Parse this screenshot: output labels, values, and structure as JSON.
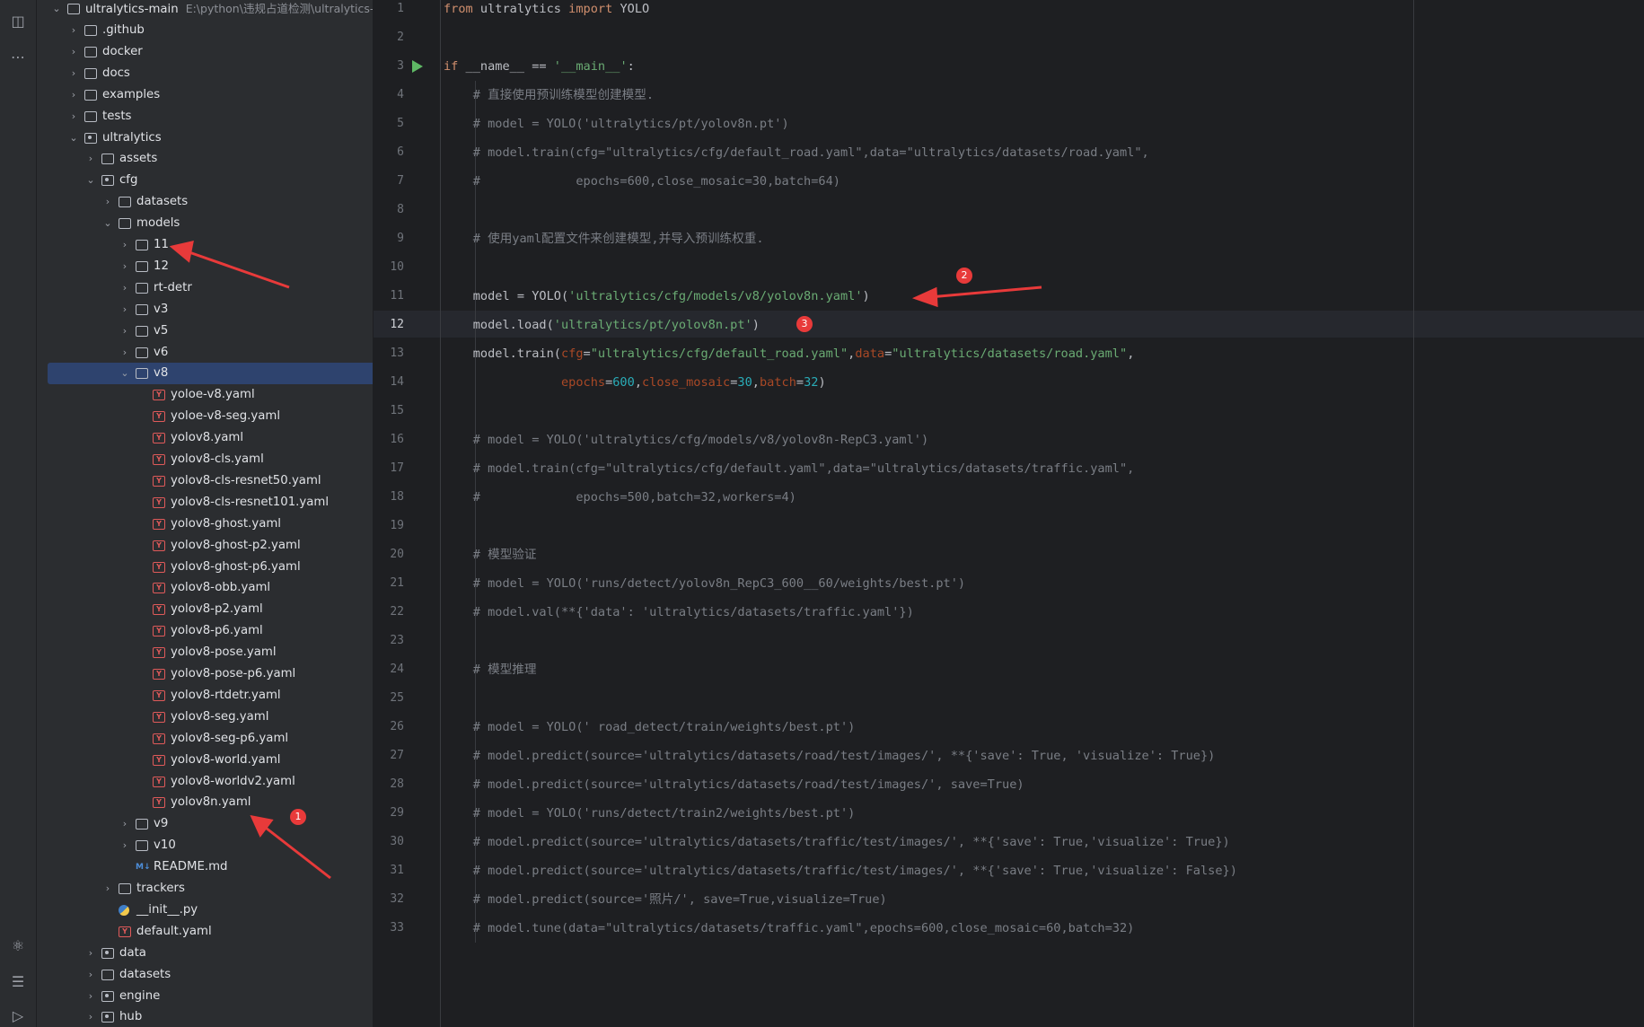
{
  "colors": {
    "accent_selected": "#2e436e",
    "annotation_red": "#e83a3a",
    "string_green": "#6aab73",
    "keyword_orange": "#cf8e6d",
    "comment_gray": "#7a7e85"
  },
  "activity": {
    "icons": [
      "structure-icon",
      "more-icon",
      "python-console-icon",
      "layers-icon",
      "services-icon"
    ]
  },
  "tree": {
    "root": {
      "label": "ultralytics-main",
      "path": "E:\\python\\违规占道检测\\ultralytics-m"
    },
    "rows": [
      {
        "label": ".github",
        "depth": 1,
        "type": "folder",
        "chev": "›"
      },
      {
        "label": "docker",
        "depth": 1,
        "type": "folder",
        "chev": "›"
      },
      {
        "label": "docs",
        "depth": 1,
        "type": "folder",
        "chev": "›"
      },
      {
        "label": "examples",
        "depth": 1,
        "type": "folder",
        "chev": "›"
      },
      {
        "label": "tests",
        "depth": 1,
        "type": "folder",
        "chev": "›"
      },
      {
        "label": "ultralytics",
        "depth": 1,
        "type": "pkg",
        "chev": "⌄"
      },
      {
        "label": "assets",
        "depth": 2,
        "type": "folder",
        "chev": "›"
      },
      {
        "label": "cfg",
        "depth": 2,
        "type": "pkg",
        "chev": "⌄"
      },
      {
        "label": "datasets",
        "depth": 3,
        "type": "folder",
        "chev": "›"
      },
      {
        "label": "models",
        "depth": 3,
        "type": "folder",
        "chev": "⌄"
      },
      {
        "label": "11",
        "depth": 4,
        "type": "folder",
        "chev": "›"
      },
      {
        "label": "12",
        "depth": 4,
        "type": "folder",
        "chev": "›"
      },
      {
        "label": "rt-detr",
        "depth": 4,
        "type": "folder",
        "chev": "›"
      },
      {
        "label": "v3",
        "depth": 4,
        "type": "folder",
        "chev": "›"
      },
      {
        "label": "v5",
        "depth": 4,
        "type": "folder",
        "chev": "›"
      },
      {
        "label": "v6",
        "depth": 4,
        "type": "folder",
        "chev": "›"
      },
      {
        "label": "v8",
        "depth": 4,
        "type": "folder",
        "chev": "⌄",
        "selected": true
      },
      {
        "label": "yoloe-v8.yaml",
        "depth": 5,
        "type": "yaml"
      },
      {
        "label": "yoloe-v8-seg.yaml",
        "depth": 5,
        "type": "yaml"
      },
      {
        "label": "yolov8.yaml",
        "depth": 5,
        "type": "yaml"
      },
      {
        "label": "yolov8-cls.yaml",
        "depth": 5,
        "type": "yaml"
      },
      {
        "label": "yolov8-cls-resnet50.yaml",
        "depth": 5,
        "type": "yaml"
      },
      {
        "label": "yolov8-cls-resnet101.yaml",
        "depth": 5,
        "type": "yaml"
      },
      {
        "label": "yolov8-ghost.yaml",
        "depth": 5,
        "type": "yaml"
      },
      {
        "label": "yolov8-ghost-p2.yaml",
        "depth": 5,
        "type": "yaml"
      },
      {
        "label": "yolov8-ghost-p6.yaml",
        "depth": 5,
        "type": "yaml"
      },
      {
        "label": "yolov8-obb.yaml",
        "depth": 5,
        "type": "yaml"
      },
      {
        "label": "yolov8-p2.yaml",
        "depth": 5,
        "type": "yaml"
      },
      {
        "label": "yolov8-p6.yaml",
        "depth": 5,
        "type": "yaml"
      },
      {
        "label": "yolov8-pose.yaml",
        "depth": 5,
        "type": "yaml"
      },
      {
        "label": "yolov8-pose-p6.yaml",
        "depth": 5,
        "type": "yaml"
      },
      {
        "label": "yolov8-rtdetr.yaml",
        "depth": 5,
        "type": "yaml"
      },
      {
        "label": "yolov8-seg.yaml",
        "depth": 5,
        "type": "yaml"
      },
      {
        "label": "yolov8-seg-p6.yaml",
        "depth": 5,
        "type": "yaml"
      },
      {
        "label": "yolov8-world.yaml",
        "depth": 5,
        "type": "yaml"
      },
      {
        "label": "yolov8-worldv2.yaml",
        "depth": 5,
        "type": "yaml"
      },
      {
        "label": "yolov8n.yaml",
        "depth": 5,
        "type": "yaml"
      },
      {
        "label": "v9",
        "depth": 4,
        "type": "folder",
        "chev": "›"
      },
      {
        "label": "v10",
        "depth": 4,
        "type": "folder",
        "chev": "›"
      },
      {
        "label": "README.md",
        "depth": 4,
        "type": "md"
      },
      {
        "label": "trackers",
        "depth": 3,
        "type": "folder",
        "chev": "›"
      },
      {
        "label": "__init__.py",
        "depth": 3,
        "type": "py"
      },
      {
        "label": "default.yaml",
        "depth": 3,
        "type": "yaml"
      },
      {
        "label": "data",
        "depth": 2,
        "type": "pkg",
        "chev": "›"
      },
      {
        "label": "datasets",
        "depth": 2,
        "type": "folder",
        "chev": "›"
      },
      {
        "label": "engine",
        "depth": 2,
        "type": "pkg",
        "chev": "›"
      },
      {
        "label": "hub",
        "depth": 2,
        "type": "pkg",
        "chev": "›"
      }
    ]
  },
  "editor": {
    "current_line": 12,
    "lines": [
      [
        [
          "kw",
          "from"
        ],
        [
          "t",
          " ultralytics "
        ],
        [
          "kw",
          "import"
        ],
        [
          "t",
          " YOLO"
        ]
      ],
      [],
      [
        [
          "kw",
          "if"
        ],
        [
          "t",
          " __name__ == "
        ],
        [
          "str",
          "'__main__'"
        ],
        [
          "t",
          ":"
        ]
      ],
      [
        [
          "t",
          "    "
        ],
        [
          "cm",
          "# 直接使用预训练模型创建模型."
        ]
      ],
      [
        [
          "t",
          "    "
        ],
        [
          "cm",
          "# model = YOLO('ultralytics/pt/yolov8n.pt')"
        ]
      ],
      [
        [
          "t",
          "    "
        ],
        [
          "cm",
          "# model.train(cfg=\"ultralytics/cfg/default_road.yaml\",data=\"ultralytics/datasets/road.yaml\","
        ]
      ],
      [
        [
          "t",
          "    "
        ],
        [
          "cm",
          "#             epochs=600,close_mosaic=30,batch=64)"
        ]
      ],
      [],
      [
        [
          "t",
          "    "
        ],
        [
          "cm",
          "# 使用yaml配置文件来创建模型,并导入预训练权重."
        ]
      ],
      [],
      [
        [
          "t",
          "    model = YOLO("
        ],
        [
          "str",
          "'ultralytics/cfg/models/v8/yolov8n.yaml'"
        ],
        [
          "t",
          ")"
        ]
      ],
      [
        [
          "t",
          "    model.load("
        ],
        [
          "str",
          "'ultralytics/pt/yolov8n.pt'"
        ],
        [
          "t",
          ")"
        ]
      ],
      [
        [
          "t",
          "    model.train("
        ],
        [
          "par",
          "cfg"
        ],
        [
          "t",
          "="
        ],
        [
          "str",
          "\"ultralytics/cfg/default_road.yaml\""
        ],
        [
          "t",
          ","
        ],
        [
          "par",
          "data"
        ],
        [
          "t",
          "="
        ],
        [
          "str",
          "\"ultralytics/datasets/road.yaml\""
        ],
        [
          "t",
          ","
        ]
      ],
      [
        [
          "t",
          "                "
        ],
        [
          "par",
          "epochs"
        ],
        [
          "t",
          "="
        ],
        [
          "num",
          "600"
        ],
        [
          "t",
          ","
        ],
        [
          "par",
          "close_mosaic"
        ],
        [
          "t",
          "="
        ],
        [
          "num",
          "30"
        ],
        [
          "t",
          ","
        ],
        [
          "par",
          "batch"
        ],
        [
          "t",
          "="
        ],
        [
          "num",
          "32"
        ],
        [
          "t",
          ")"
        ]
      ],
      [],
      [
        [
          "t",
          "    "
        ],
        [
          "cm",
          "# model = YOLO('ultralytics/cfg/models/v8/yolov8n-RepC3.yaml')"
        ]
      ],
      [
        [
          "t",
          "    "
        ],
        [
          "cm",
          "# model.train(cfg=\"ultralytics/cfg/default.yaml\",data=\"ultralytics/datasets/traffic.yaml\","
        ]
      ],
      [
        [
          "t",
          "    "
        ],
        [
          "cm",
          "#             epochs=500,batch=32,workers=4)"
        ]
      ],
      [],
      [
        [
          "t",
          "    "
        ],
        [
          "cm",
          "# 模型验证"
        ]
      ],
      [
        [
          "t",
          "    "
        ],
        [
          "cm",
          "# model = YOLO('runs/detect/yolov8n_RepC3_600__60/weights/best.pt')"
        ]
      ],
      [
        [
          "t",
          "    "
        ],
        [
          "cm",
          "# model.val(**{'data': 'ultralytics/datasets/traffic.yaml'})"
        ]
      ],
      [],
      [
        [
          "t",
          "    "
        ],
        [
          "cm",
          "# 模型推理"
        ]
      ],
      [],
      [
        [
          "t",
          "    "
        ],
        [
          "cm",
          "# model = YOLO(' road_detect/train/weights/best.pt')"
        ]
      ],
      [
        [
          "t",
          "    "
        ],
        [
          "cm",
          "# model.predict(source='ultralytics/datasets/road/test/images/', **{'save': True, 'visualize': True})"
        ]
      ],
      [
        [
          "t",
          "    "
        ],
        [
          "cm",
          "# model.predict(source='ultralytics/datasets/road/test/images/', save=True)"
        ]
      ],
      [
        [
          "t",
          "    "
        ],
        [
          "cm",
          "# model = YOLO('runs/detect/train2/weights/best.pt')"
        ]
      ],
      [
        [
          "t",
          "    "
        ],
        [
          "cm",
          "# model.predict(source='ultralytics/datasets/traffic/test/images/', **{'save': True,'visualize': True})"
        ]
      ],
      [
        [
          "t",
          "    "
        ],
        [
          "cm",
          "# model.predict(source='ultralytics/datasets/traffic/test/images/', **{'save': True,'visualize': False})"
        ]
      ],
      [
        [
          "t",
          "    "
        ],
        [
          "cm",
          "# model.predict(source='照片/', save=True,visualize=True)"
        ]
      ],
      [
        [
          "t",
          "    "
        ],
        [
          "cm",
          "# model.tune(data=\"ultralytics/datasets/traffic.yaml\",epochs=600,close_mosaic=60,batch=32)"
        ]
      ]
    ]
  },
  "annotations": {
    "badges": [
      "1",
      "2",
      "3"
    ]
  }
}
